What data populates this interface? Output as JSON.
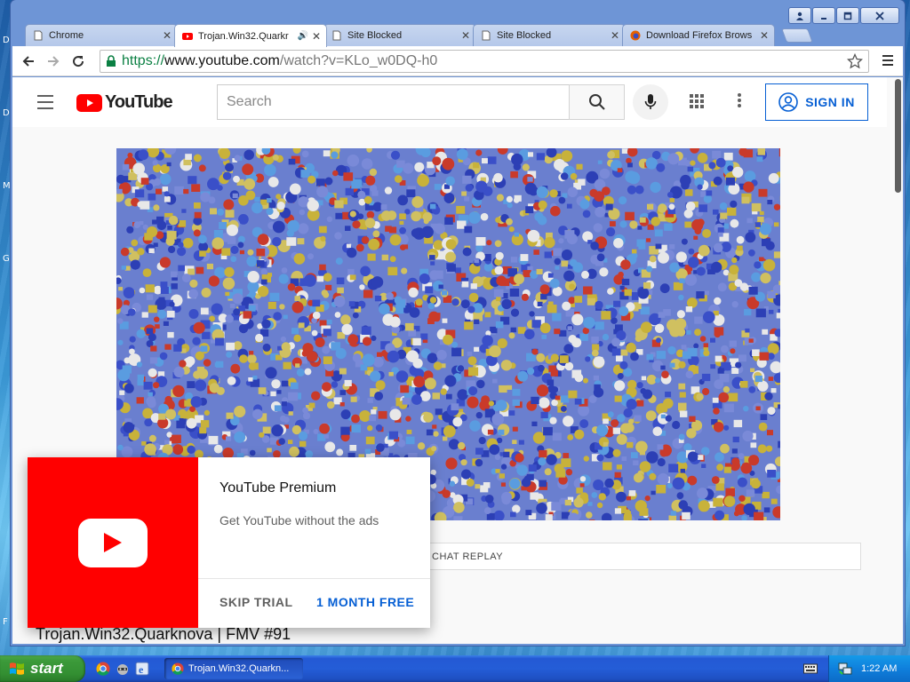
{
  "desktop": {
    "edge_letters": [
      "D",
      "M",
      "G",
      "F"
    ]
  },
  "window": {
    "controls": {
      "user": "",
      "minimize": "",
      "maximize": "",
      "close": ""
    }
  },
  "tabs": [
    {
      "title": "Chrome",
      "icon": "page-icon"
    },
    {
      "title": "Trojan.Win32.Quarkr",
      "icon": "youtube-icon",
      "active": true,
      "audio": true
    },
    {
      "title": "Site Blocked",
      "icon": "page-icon"
    },
    {
      "title": "Site Blocked",
      "icon": "page-icon"
    },
    {
      "title": "Download Firefox Brows",
      "icon": "firefox-icon"
    }
  ],
  "address_bar": {
    "scheme": "https://",
    "host": "www.youtube.com",
    "path": "/watch?v=KLo_w0DQ-h0"
  },
  "youtube": {
    "logo_text": "YouTube",
    "search_placeholder": "Search",
    "signin_label": "SIGN IN",
    "chat_replay_label": "CHAT REPLAY",
    "video_title": "Trojan.Win32.Quarknova | FMV #91"
  },
  "premium_popup": {
    "title": "YouTube Premium",
    "subtitle": "Get YouTube without the ads",
    "skip_label": "SKIP TRIAL",
    "free_label": "1 MONTH FREE"
  },
  "taskbar": {
    "start_label": "start",
    "task_label": "Trojan.Win32.Quarkn...",
    "clock": "1:22 AM"
  },
  "colors": {
    "youtube_red": "#ff0000",
    "link_blue": "#065fd4",
    "xp_taskbar_blue": "#245dd7",
    "xp_start_green": "#3c9a3a"
  }
}
